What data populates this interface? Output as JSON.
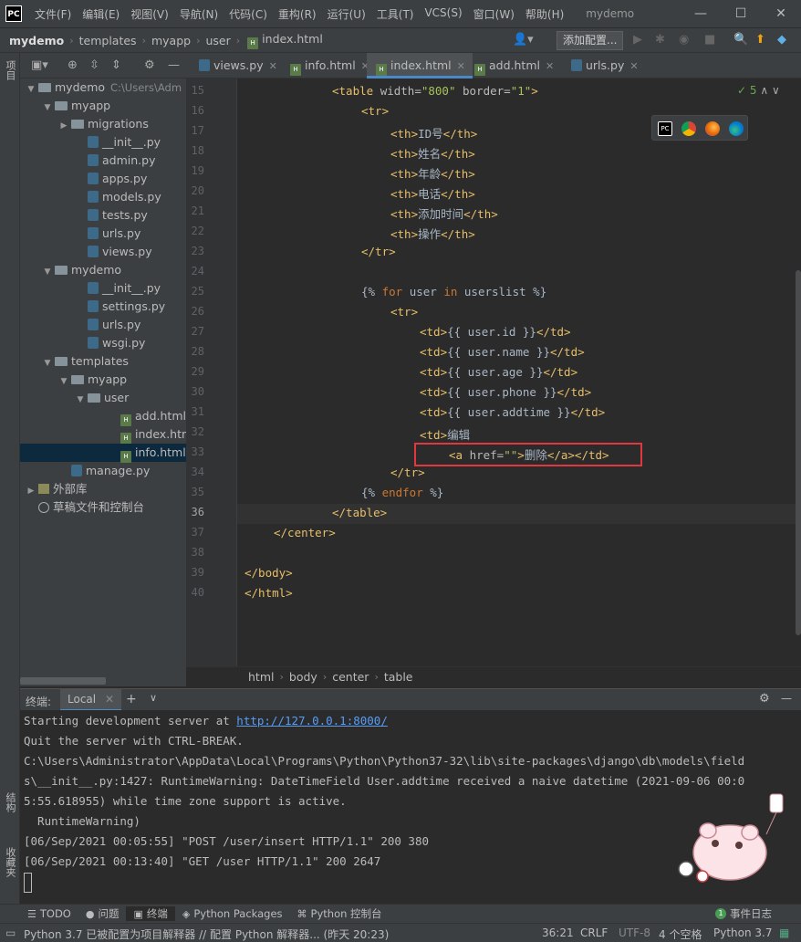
{
  "menubar": {
    "items": [
      "文件(F)",
      "编辑(E)",
      "视图(V)",
      "导航(N)",
      "代码(C)",
      "重构(R)",
      "运行(U)",
      "工具(T)",
      "VCS(S)",
      "窗口(W)",
      "帮助(H)"
    ],
    "project_title": "mydemo"
  },
  "navbar": {
    "crumbs": [
      "mydemo",
      "templates",
      "myapp",
      "user",
      "index.html"
    ],
    "run_config": "添加配置..."
  },
  "left_strip": {
    "project": "项目",
    "structure": "结构",
    "favorites": "收藏夹"
  },
  "tree": [
    {
      "label": "mydemo",
      "hint": "C:\\Users\\Adm",
      "depth": 0,
      "kind": "folder",
      "open": true
    },
    {
      "label": "myapp",
      "depth": 1,
      "kind": "folder",
      "open": true
    },
    {
      "label": "migrations",
      "depth": 2,
      "kind": "folder",
      "open": false
    },
    {
      "label": "__init__.py",
      "depth": 3,
      "kind": "py"
    },
    {
      "label": "admin.py",
      "depth": 3,
      "kind": "py"
    },
    {
      "label": "apps.py",
      "depth": 3,
      "kind": "py"
    },
    {
      "label": "models.py",
      "depth": 3,
      "kind": "py"
    },
    {
      "label": "tests.py",
      "depth": 3,
      "kind": "py"
    },
    {
      "label": "urls.py",
      "depth": 3,
      "kind": "py"
    },
    {
      "label": "views.py",
      "depth": 3,
      "kind": "py"
    },
    {
      "label": "mydemo",
      "depth": 1,
      "kind": "folder",
      "open": true
    },
    {
      "label": "__init__.py",
      "depth": 3,
      "kind": "py"
    },
    {
      "label": "settings.py",
      "depth": 3,
      "kind": "py"
    },
    {
      "label": "urls.py",
      "depth": 3,
      "kind": "py"
    },
    {
      "label": "wsgi.py",
      "depth": 3,
      "kind": "py"
    },
    {
      "label": "templates",
      "depth": 1,
      "kind": "folder",
      "open": true
    },
    {
      "label": "myapp",
      "depth": 2,
      "kind": "folder",
      "open": true
    },
    {
      "label": "user",
      "depth": 3,
      "kind": "folder",
      "open": true
    },
    {
      "label": "add.html",
      "depth": 5,
      "kind": "html"
    },
    {
      "label": "index.html",
      "depth": 5,
      "kind": "html"
    },
    {
      "label": "info.html",
      "depth": 5,
      "kind": "html",
      "selected": true
    },
    {
      "label": "manage.py",
      "depth": 2,
      "kind": "py"
    },
    {
      "label": "外部库",
      "depth": 0,
      "kind": "lib",
      "open": false
    },
    {
      "label": "草稿文件和控制台",
      "depth": 0,
      "kind": "scratch"
    }
  ],
  "tabs": [
    {
      "label": "views.py",
      "kind": "py"
    },
    {
      "label": "info.html",
      "kind": "html"
    },
    {
      "label": "index.html",
      "kind": "html",
      "active": true
    },
    {
      "label": "add.html",
      "kind": "html"
    },
    {
      "label": "urls.py",
      "kind": "py"
    }
  ],
  "editor": {
    "inspection_count": "5",
    "current_line": "36",
    "lines": [
      {
        "n": "15",
        "indent": 3,
        "parts": [
          [
            "tg",
            "<table "
          ],
          [
            "at",
            "width="
          ],
          [
            "st",
            "\"800\" "
          ],
          [
            "at",
            "border="
          ],
          [
            "st",
            "\"1\""
          ],
          [
            "tg",
            ">"
          ]
        ]
      },
      {
        "n": "16",
        "indent": 4,
        "parts": [
          [
            "tg",
            "<tr>"
          ]
        ]
      },
      {
        "n": "17",
        "indent": 5,
        "parts": [
          [
            "tg",
            "<th>"
          ],
          [
            "tx",
            "ID号"
          ],
          [
            "tg",
            "</th>"
          ]
        ]
      },
      {
        "n": "18",
        "indent": 5,
        "parts": [
          [
            "tg",
            "<th>"
          ],
          [
            "tx",
            "姓名"
          ],
          [
            "tg",
            "</th>"
          ]
        ]
      },
      {
        "n": "19",
        "indent": 5,
        "parts": [
          [
            "tg",
            "<th>"
          ],
          [
            "tx",
            "年龄"
          ],
          [
            "tg",
            "</th>"
          ]
        ]
      },
      {
        "n": "20",
        "indent": 5,
        "parts": [
          [
            "tg",
            "<th>"
          ],
          [
            "tx",
            "电话"
          ],
          [
            "tg",
            "</th>"
          ]
        ]
      },
      {
        "n": "21",
        "indent": 5,
        "parts": [
          [
            "tg",
            "<th>"
          ],
          [
            "tx",
            "添加时间"
          ],
          [
            "tg",
            "</th>"
          ]
        ]
      },
      {
        "n": "22",
        "indent": 5,
        "parts": [
          [
            "tg",
            "<th>"
          ],
          [
            "tx",
            "操作"
          ],
          [
            "tg",
            "</th>"
          ]
        ]
      },
      {
        "n": "23",
        "indent": 4,
        "parts": [
          [
            "tg",
            "</tr>"
          ]
        ]
      },
      {
        "n": "24",
        "indent": 0,
        "parts": []
      },
      {
        "n": "25",
        "indent": 4,
        "parts": [
          [
            "tx",
            "{% "
          ],
          [
            "tp",
            "for "
          ],
          [
            "tx",
            "user "
          ],
          [
            "tp",
            "in "
          ],
          [
            "tx",
            "userslist %}"
          ]
        ]
      },
      {
        "n": "26",
        "indent": 5,
        "parts": [
          [
            "tg",
            "<tr>"
          ]
        ]
      },
      {
        "n": "27",
        "indent": 6,
        "parts": [
          [
            "tg",
            "<td>"
          ],
          [
            "tx",
            "{{ user.id }}"
          ],
          [
            "tg",
            "</td>"
          ]
        ]
      },
      {
        "n": "28",
        "indent": 6,
        "parts": [
          [
            "tg",
            "<td>"
          ],
          [
            "tx",
            "{{ user.name }}"
          ],
          [
            "tg",
            "</td>"
          ]
        ]
      },
      {
        "n": "29",
        "indent": 6,
        "parts": [
          [
            "tg",
            "<td>"
          ],
          [
            "tx",
            "{{ user.age }}"
          ],
          [
            "tg",
            "</td>"
          ]
        ]
      },
      {
        "n": "30",
        "indent": 6,
        "parts": [
          [
            "tg",
            "<td>"
          ],
          [
            "tx",
            "{{ user.phone }}"
          ],
          [
            "tg",
            "</td>"
          ]
        ]
      },
      {
        "n": "31",
        "indent": 6,
        "parts": [
          [
            "tg",
            "<td>"
          ],
          [
            "tx",
            "{{ user.addtime }}"
          ],
          [
            "tg",
            "</td>"
          ]
        ]
      },
      {
        "n": "32",
        "indent": 6,
        "parts": [
          [
            "tg",
            "<td>"
          ],
          [
            "tx",
            "编辑"
          ]
        ]
      },
      {
        "n": "33",
        "indent": 7,
        "parts": [
          [
            "tg",
            "<a "
          ],
          [
            "at",
            "href="
          ],
          [
            "st",
            "\"\""
          ],
          [
            "tg",
            ">"
          ],
          [
            "tx",
            "删除"
          ],
          [
            "tg",
            "</a></td>"
          ]
        ]
      },
      {
        "n": "34",
        "indent": 5,
        "parts": [
          [
            "tg",
            "</tr>"
          ]
        ]
      },
      {
        "n": "35",
        "indent": 4,
        "parts": [
          [
            "tx",
            "{% "
          ],
          [
            "tp",
            "endfor "
          ],
          [
            "tx",
            "%}"
          ]
        ]
      },
      {
        "n": "36",
        "indent": 3,
        "parts": [
          [
            "tg",
            "</table>"
          ]
        ]
      },
      {
        "n": "37",
        "indent": 1,
        "parts": [
          [
            "tg",
            "</center>"
          ]
        ]
      },
      {
        "n": "38",
        "indent": 0,
        "parts": []
      },
      {
        "n": "39",
        "indent": 0,
        "parts": [
          [
            "tg",
            "</body>"
          ]
        ]
      },
      {
        "n": "40",
        "indent": 0,
        "parts": [
          [
            "tg",
            "</html>"
          ]
        ]
      }
    ]
  },
  "browsers": [
    "PyCharm",
    "Chrome",
    "Firefox",
    "Edge"
  ],
  "breadcrumb": [
    "html",
    "body",
    "center",
    "table"
  ],
  "terminal": {
    "title": "终端:",
    "tab": "Local",
    "lines": [
      {
        "text": "Starting development server at ",
        "link": "http://127.0.0.1:8000/"
      },
      {
        "text": "Quit the server with CTRL-BREAK."
      },
      {
        "text": "C:\\Users\\Administrator\\AppData\\Local\\Programs\\Python\\Python37-32\\lib\\site-packages\\django\\db\\models\\field"
      },
      {
        "text": "s\\__init__.py:1427: RuntimeWarning: DateTimeField User.addtime received a naive datetime (2021-09-06 00:0"
      },
      {
        "text": "5:55.618955) while time zone support is active."
      },
      {
        "text": "  RuntimeWarning)"
      },
      {
        "text": "[06/Sep/2021 00:05:55] \"POST /user/insert HTTP/1.1\" 200 380"
      },
      {
        "text": "[06/Sep/2021 00:13:40] \"GET /user HTTP/1.1\" 200 2647"
      }
    ]
  },
  "toolwindows": [
    "TODO",
    "问题",
    "终端",
    "Python Packages",
    "Python 控制台"
  ],
  "event_log": {
    "count": "1",
    "label": "事件日志"
  },
  "status": {
    "message": "Python 3.7 已被配置为项目解释器 // 配置 Python 解释器... (昨天 20:23)",
    "position": "36:21",
    "line_sep": "CRLF",
    "encoding": "UTF-8",
    "indent": "4 个空格",
    "interpreter": "Python 3.7"
  },
  "colors": {
    "accent": "#4a88c7",
    "highlight_box": "#e0383e",
    "selection": "#0d293e"
  }
}
